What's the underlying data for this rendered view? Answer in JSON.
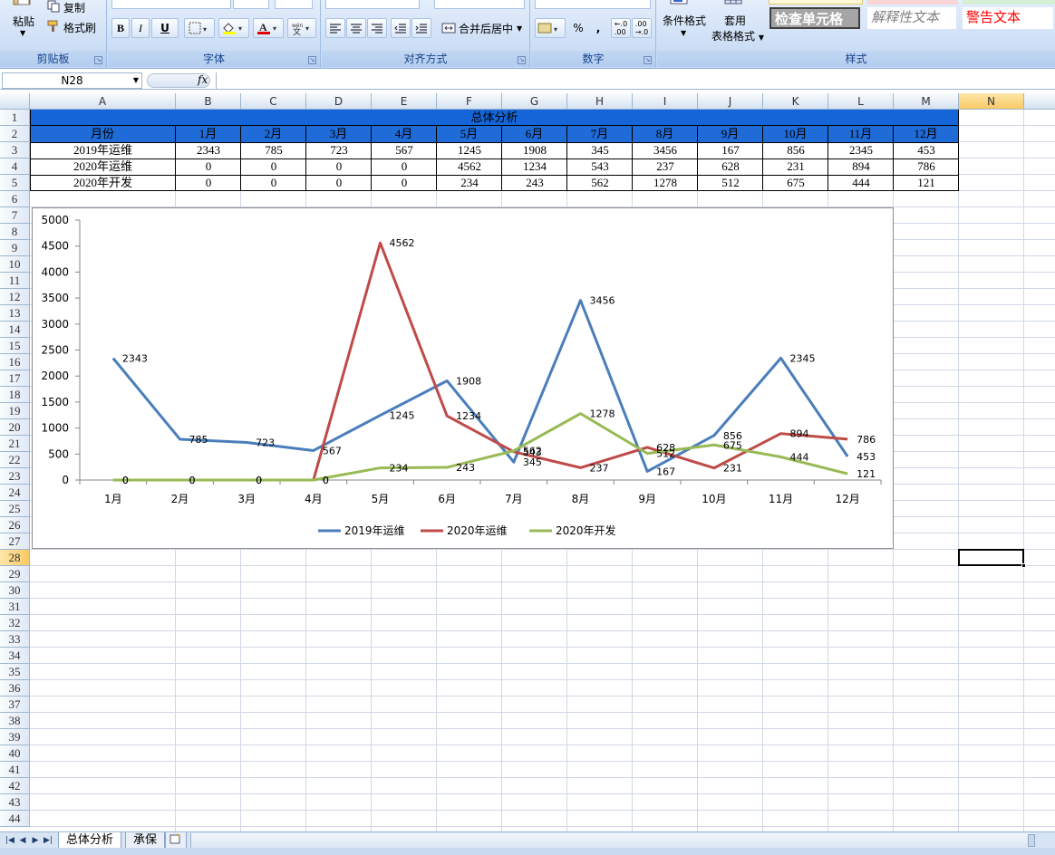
{
  "ribbon": {
    "clipboard": {
      "paste": "粘贴",
      "copy": "复制",
      "format_painter": "格式刷",
      "title": "剪贴板"
    },
    "font": {
      "title": "字体",
      "bold": "B",
      "italic": "I",
      "underline": "U"
    },
    "alignment": {
      "title": "对齐方式",
      "merge_center": "合并后居中"
    },
    "number": {
      "title": "数字",
      "percent": "%",
      "comma": ","
    },
    "styles": {
      "title": "样式",
      "conditional_format": "条件格式",
      "table_format_1": "套用",
      "table_format_2": "表格格式",
      "check_cell": "检查单元格",
      "explanatory_text": "解释性文本",
      "warning_text": "警告文本"
    }
  },
  "formula_bar": {
    "name_box": "N28",
    "fx": "fx",
    "formula": ""
  },
  "columns": [
    "A",
    "B",
    "C",
    "D",
    "E",
    "F",
    "G",
    "H",
    "I",
    "J",
    "K",
    "L",
    "M",
    "N"
  ],
  "rows": [
    "1",
    "2",
    "3",
    "4",
    "5",
    "6",
    "7",
    "8",
    "9",
    "10",
    "11",
    "12",
    "13",
    "14",
    "15",
    "16",
    "17",
    "18",
    "19",
    "20",
    "21",
    "22",
    "23",
    "24",
    "25",
    "26",
    "27",
    "28",
    "29",
    "30",
    "31",
    "32",
    "33",
    "34",
    "35",
    "36",
    "37",
    "38",
    "39",
    "40",
    "41",
    "42",
    "43",
    "44"
  ],
  "table": {
    "title": "总体分析",
    "header": [
      "月份",
      "1月",
      "2月",
      "3月",
      "4月",
      "5月",
      "6月",
      "7月",
      "8月",
      "9月",
      "10月",
      "11月",
      "12月"
    ],
    "rows": [
      [
        "2019年运维",
        "2343",
        "785",
        "723",
        "567",
        "1245",
        "1908",
        "345",
        "3456",
        "167",
        "856",
        "2345",
        "453"
      ],
      [
        "2020年运维",
        "0",
        "0",
        "0",
        "0",
        "4562",
        "1234",
        "543",
        "237",
        "628",
        "231",
        "894",
        "786"
      ],
      [
        "2020年开发",
        "0",
        "0",
        "0",
        "0",
        "234",
        "243",
        "562",
        "1278",
        "512",
        "675",
        "444",
        "121"
      ]
    ]
  },
  "chart_data": {
    "type": "line",
    "categories": [
      "1月",
      "2月",
      "3月",
      "4月",
      "5月",
      "6月",
      "7月",
      "8月",
      "9月",
      "10月",
      "11月",
      "12月"
    ],
    "series": [
      {
        "name": "2019年运维",
        "color": "#4a7ebb",
        "values": [
          2343,
          785,
          723,
          567,
          1245,
          1908,
          345,
          3456,
          167,
          856,
          2345,
          453
        ]
      },
      {
        "name": "2020年运维",
        "color": "#be4b48",
        "values": [
          0,
          0,
          0,
          0,
          4562,
          1234,
          543,
          237,
          628,
          231,
          894,
          786
        ]
      },
      {
        "name": "2020年开发",
        "color": "#98b954",
        "values": [
          0,
          0,
          0,
          0,
          234,
          243,
          562,
          1278,
          512,
          675,
          444,
          121
        ]
      }
    ],
    "ylim": [
      0,
      5000
    ],
    "yticks": [
      0,
      500,
      1000,
      1500,
      2000,
      2500,
      3000,
      3500,
      4000,
      4500,
      5000
    ],
    "legend": "bottom",
    "grid": false,
    "data_labels": true
  },
  "sheets": [
    {
      "name": "总体分析",
      "active": true
    },
    {
      "name": "承保",
      "active": false
    }
  ],
  "colors": {
    "header_fill": "#1f6bd8",
    "title_fill": "#1565d8"
  }
}
